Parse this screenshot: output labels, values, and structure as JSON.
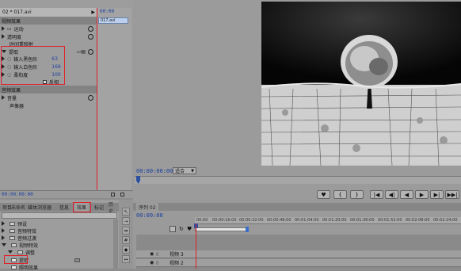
{
  "effect_controls": {
    "clip_title": "02 * 017.avi",
    "clip_label": "017.avi",
    "timecode_top": "00:00",
    "video_effects_header": "视频效果",
    "motion_label": "运动",
    "opacity_label": "透明度",
    "time_remap_label": "时间重映射",
    "extract_label": "提取",
    "params": [
      {
        "label": "输入黑色阶",
        "value": "63"
      },
      {
        "label": "输入白色阶",
        "value": "169"
      },
      {
        "label": "柔和度",
        "value": "100"
      }
    ],
    "invert_label": "反相",
    "audio_effects_header": "音频效果",
    "volume_label": "音量",
    "panner_label": "声像器",
    "bottom_timecode": "00:00:00:00"
  },
  "project_panel": {
    "tabs": [
      "项目",
      "未命名",
      "媒体浏览器",
      "信息",
      "效果",
      "标记",
      "历史"
    ],
    "active_tab": "效果",
    "tree": [
      {
        "label": "预设"
      },
      {
        "label": "音频特效"
      },
      {
        "label": "音频过渡"
      },
      {
        "label": "视频特效"
      },
      {
        "label": "调整"
      },
      {
        "label": "提取"
      },
      {
        "label": "照明效果"
      }
    ]
  },
  "monitor": {
    "timecode": "00:00:00:00",
    "fit_label": "适合",
    "buttons": [
      "♥",
      "{",
      "}",
      "|◀",
      "◀|",
      "◀",
      "▶",
      "▶|",
      "▶▶|"
    ]
  },
  "timeline": {
    "tab_label": "序列 02",
    "timecode": "00:00:00",
    "ruler_labels": [
      "00:00",
      "00:00:16:00",
      "00:00:32:00",
      "00:00:48:00",
      "00:01:04:00",
      "00:01:20:00",
      "00:01:36:00",
      "00:01:52:00",
      "00:02:08:00",
      "00:02:24:00"
    ],
    "tracks": [
      {
        "label": "视频 3"
      },
      {
        "label": "视频 2"
      }
    ]
  },
  "colors": {
    "highlight": "#e0202a",
    "timecode": "#1a3fa0",
    "clip": "#bcd0ee"
  }
}
